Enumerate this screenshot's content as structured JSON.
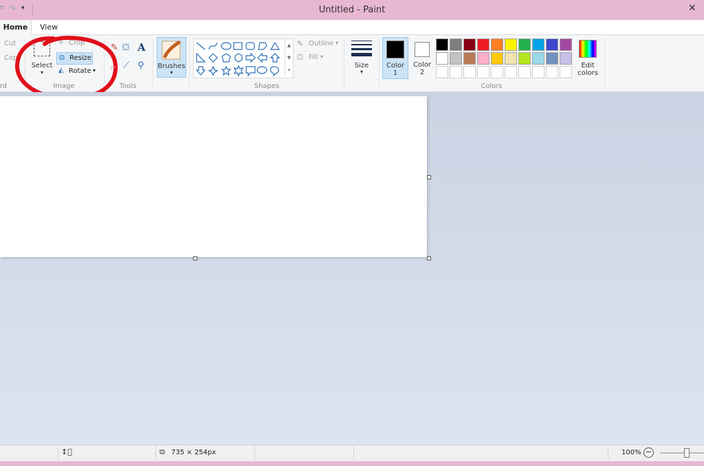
{
  "window": {
    "title": "Untitled - Paint"
  },
  "tabs": [
    "Home",
    "View"
  ],
  "clipboard": {
    "cut": "Cut",
    "copy": "Copy",
    "group": "Clipboard"
  },
  "image": {
    "crop": "Crop",
    "resize": "Resize",
    "rotate": "Rotate",
    "select": "Select",
    "group": "Image"
  },
  "tools": {
    "group": "Tools"
  },
  "brushes": {
    "label": "Brushes"
  },
  "shapes": {
    "outline": "Outline",
    "fill": "Fill",
    "group": "Shapes"
  },
  "size": {
    "label": "Size"
  },
  "colors": {
    "color1": "Color\n1",
    "color2": "Color\n2",
    "color1_label_a": "Color",
    "color1_label_b": "1",
    "color2_label_a": "Color",
    "color2_label_b": "2",
    "edit_a": "Edit",
    "edit_b": "colors",
    "group": "Colors",
    "palette_row1": [
      "#000000",
      "#7f7f7f",
      "#880015",
      "#ed1c24",
      "#ff7f27",
      "#fff200",
      "#22b14c",
      "#00a2e8",
      "#3f48cc",
      "#a349a4"
    ],
    "palette_row2": [
      "#ffffff",
      "#c3c3c3",
      "#b97a57",
      "#ffaec9",
      "#ffc90e",
      "#efe4b0",
      "#b5e61d",
      "#99d9ea",
      "#7092be",
      "#c8bfe7"
    ],
    "palette_row3": [
      "#ffffff",
      "#ffffff",
      "#ffffff",
      "#ffffff",
      "#ffffff",
      "#ffffff",
      "#ffffff",
      "#ffffff",
      "#ffffff",
      "#ffffff"
    ]
  },
  "status": {
    "dimensions": "735 × 254px",
    "zoom": "100%"
  },
  "annotation_color": "#e0101a"
}
